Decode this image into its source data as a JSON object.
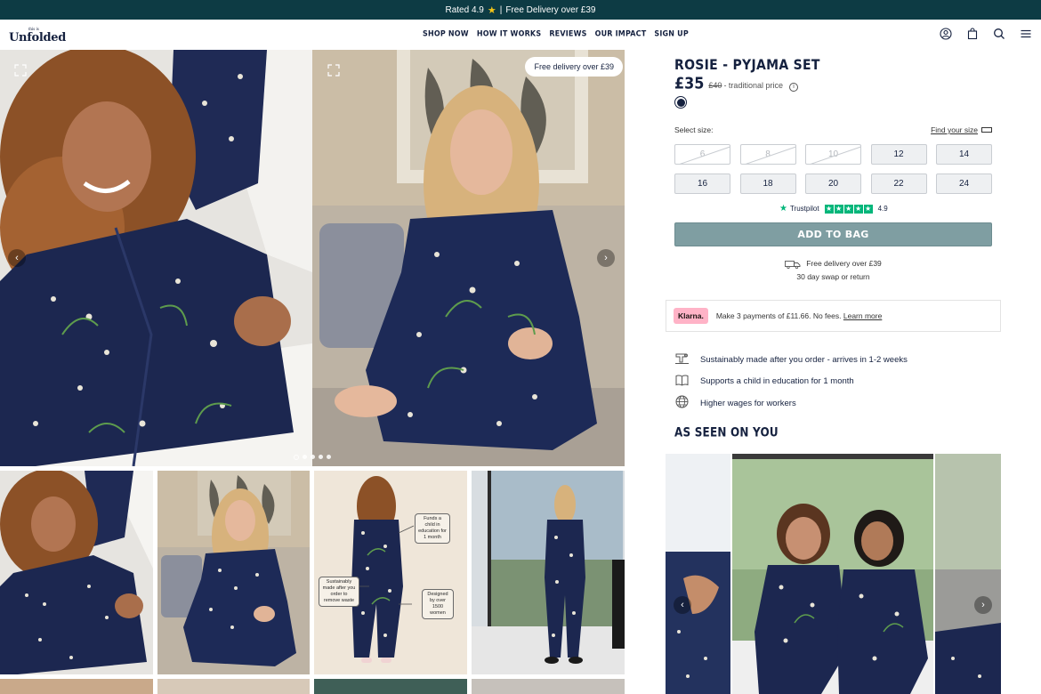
{
  "announcement": {
    "rated": "Rated 4.9",
    "separator": "|",
    "delivery": "Free Delivery over £39"
  },
  "header": {
    "logo_pre": "this is",
    "logo_word": "Unfolded",
    "nav": [
      "SHOP NOW",
      "HOW IT WORKS",
      "REVIEWS",
      "OUR IMPACT",
      "SIGN UP"
    ],
    "icons": [
      "account-icon",
      "bag-icon",
      "search-icon",
      "menu-icon"
    ]
  },
  "gallery": {
    "badge": "Free delivery over £39",
    "dots_count": 5,
    "active_dot": 0,
    "thumb_callouts": [
      "Funds a child in education for 1 month",
      "Sustainably made after you order to remove waste",
      "Designed by over 1500 women"
    ]
  },
  "product": {
    "title": "ROSIE - PYJAMA SET",
    "price": "£35",
    "was_price": "£40",
    "was_label": "- traditional price",
    "info": "i",
    "swatch_color": "#15213f",
    "select_size_label": "Select size:",
    "find_size_label": "Find your size",
    "sizes": [
      {
        "label": "6",
        "available": false
      },
      {
        "label": "8",
        "available": false
      },
      {
        "label": "10",
        "available": false
      },
      {
        "label": "12",
        "available": true
      },
      {
        "label": "14",
        "available": true
      },
      {
        "label": "16",
        "available": true
      },
      {
        "label": "18",
        "available": true
      },
      {
        "label": "20",
        "available": true
      },
      {
        "label": "22",
        "available": true
      },
      {
        "label": "24",
        "available": true
      }
    ],
    "trustpilot": {
      "name": "Trustpilot",
      "score": "4.9",
      "stars": 5
    },
    "add_to_bag": "ADD TO BAG",
    "delivery_line1": "Free delivery over £39",
    "delivery_line2": "30 day swap or return"
  },
  "klarna": {
    "badge": "Klarna.",
    "text": "Make 3 payments of £11.66. No fees.",
    "link": "Learn more"
  },
  "features": [
    {
      "icon": "sewing-machine-icon",
      "text": "Sustainably made after you order - arrives in 1-2 weeks"
    },
    {
      "icon": "book-icon",
      "text": "Supports a child in education for 1 month"
    },
    {
      "icon": "globe-icon",
      "text": "Higher wages for workers"
    }
  ],
  "as_seen_on_you": {
    "heading": "AS SEEN ON YOU"
  },
  "colors": {
    "brand_dark": "#0d3b44",
    "navy": "#15213f",
    "add_to_bag": "#7f9ea2",
    "trustpilot_green": "#00b67a",
    "klarna_pink": "#ffb3c7",
    "rating_star": "#f5c518"
  }
}
